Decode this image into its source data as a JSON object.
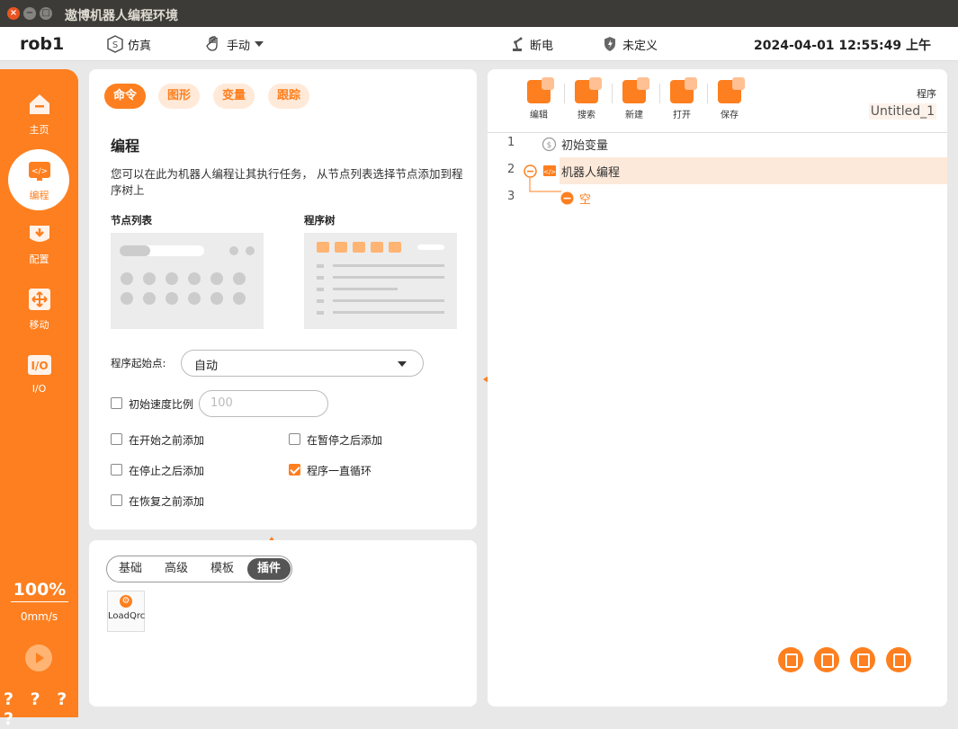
{
  "window": {
    "title": "遨博机器人编程环境",
    "close_glyph": "×",
    "min_glyph": "−",
    "max_glyph": "□"
  },
  "topbar": {
    "robot_name": "rob1",
    "sim_label": "仿真",
    "mode_label": "手动",
    "status_power": "断电",
    "status_safety": "未定义",
    "datetime": "2024-04-01 12:55:49 上午"
  },
  "sidebar": {
    "items": [
      {
        "label": "主页",
        "icon": "home-icon"
      },
      {
        "label": "编程",
        "icon": "code-icon"
      },
      {
        "label": "配置",
        "icon": "config-icon"
      },
      {
        "label": "移动",
        "icon": "move-icon"
      },
      {
        "label": "I/O",
        "icon": "io-icon"
      }
    ],
    "speed_percent": "100%",
    "speed_value": "0mm/s",
    "help_marks": "? ? ? ?"
  },
  "left_panel": {
    "pills": [
      "命令",
      "图形",
      "变量",
      "跟踪"
    ],
    "heading": "编程",
    "description": "您可以在此为机器人编程让其执行任务，  从节点列表选择节点添加到程序树上",
    "node_list_label": "节点列表",
    "program_tree_label": "程序树",
    "start_point_label": "程序起始点:",
    "start_point_value": "自动",
    "init_speed_label": "初始速度比例",
    "init_speed_placeholder": "100",
    "checks": [
      {
        "label": "在开始之前添加",
        "checked": false
      },
      {
        "label": "在暂停之后添加",
        "checked": false
      },
      {
        "label": "在停止之后添加",
        "checked": false
      },
      {
        "label": "程序一直循环",
        "checked": true
      },
      {
        "label": "在恢复之前添加",
        "checked": false
      }
    ]
  },
  "node_panel": {
    "tabs": [
      "基础",
      "高级",
      "模板",
      "插件"
    ],
    "active_tab": "插件",
    "plugin_label": "LoadQrc"
  },
  "right_panel": {
    "tools": [
      "编辑",
      "搜索",
      "新建",
      "打开",
      "保存"
    ],
    "program_label": "程序",
    "program_name": "Untitled_1",
    "tree": [
      {
        "line": "1",
        "text": "初始变量"
      },
      {
        "line": "2",
        "text": "机器人编程"
      },
      {
        "line": "3",
        "text": "空"
      }
    ],
    "accent": "#fd7f1f"
  }
}
